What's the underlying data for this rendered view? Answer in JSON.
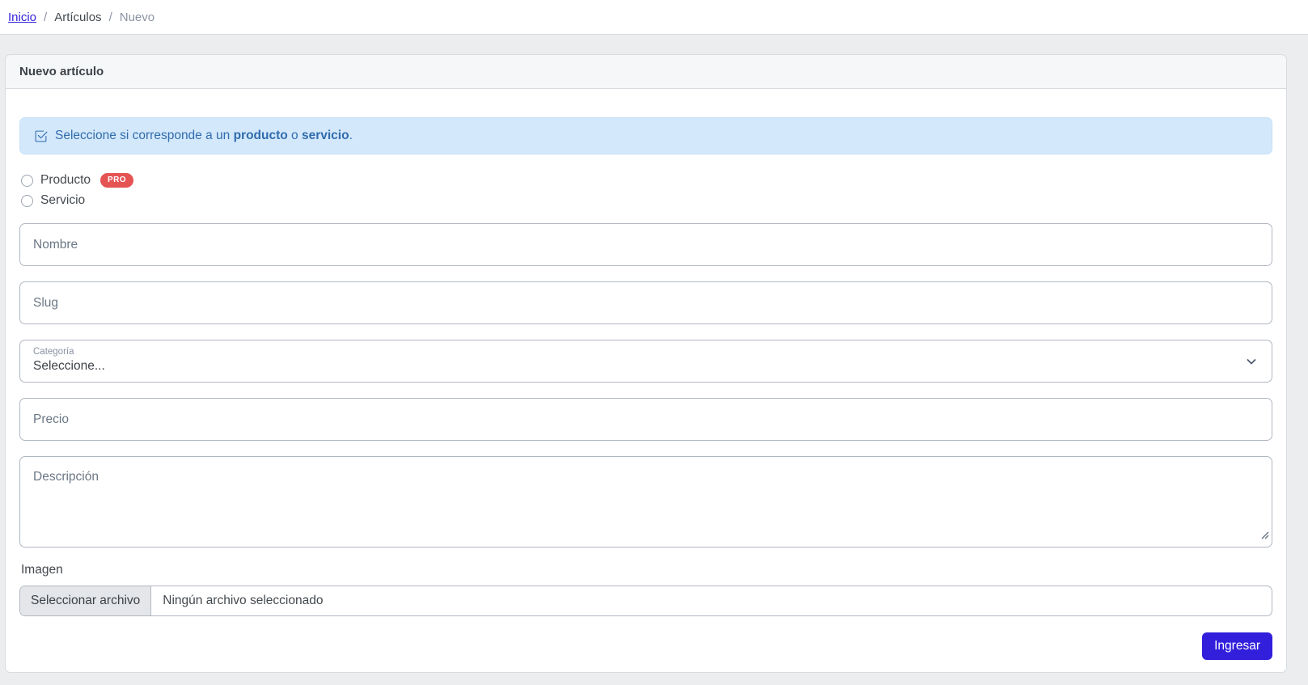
{
  "breadcrumb": {
    "separator": "/",
    "items": [
      {
        "label": "Inicio"
      },
      {
        "label": "Artículos"
      },
      {
        "label": "Nuevo"
      }
    ]
  },
  "card": {
    "title": "Nuevo artículo"
  },
  "alert": {
    "icon": "check-square-icon",
    "part1": "Seleccione si corresponde a un ",
    "bold1": "producto",
    "part2": " o ",
    "bold2": "servicio",
    "part3": "."
  },
  "radios": [
    {
      "label": "Producto",
      "badge": "PRO"
    },
    {
      "label": "Servicio"
    }
  ],
  "form": {
    "nombre": {
      "placeholder": "Nombre",
      "value": ""
    },
    "slug": {
      "placeholder": "Slug",
      "value": ""
    },
    "categoria": {
      "label": "Categoría",
      "value": "Seleccione...",
      "icon": "chevron-down-icon"
    },
    "precio": {
      "placeholder": "Precio",
      "value": ""
    },
    "descripcion": {
      "placeholder": "Descripción",
      "value": ""
    },
    "imagen": {
      "label": "Imagen",
      "button": "Seleccionar archivo",
      "empty_text": "Ningún archivo seleccionado"
    },
    "submit_label": "Ingresar"
  },
  "colors": {
    "accent": "#321fdb",
    "badge_danger": "#e55353",
    "alert_bg": "#d3e8fb",
    "alert_text": "#316cac",
    "page_bg": "#ebedef"
  }
}
